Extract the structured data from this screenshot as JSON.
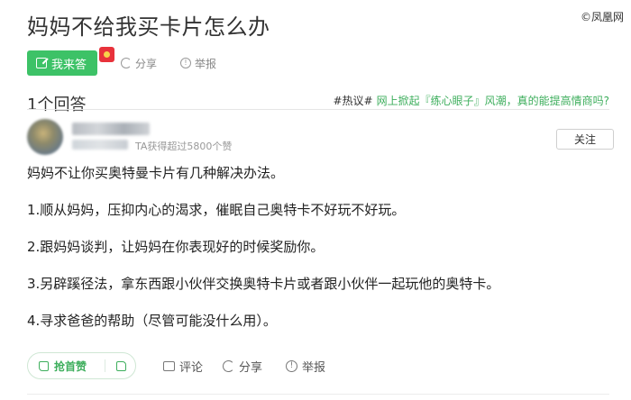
{
  "watermark": "©凤凰网",
  "question": {
    "title": "妈妈不给我买卡片怎么办"
  },
  "actions": {
    "answer_label": "我来答",
    "share_label": "分享",
    "report_label": "举报"
  },
  "answers_header": {
    "count_label": "1个回答",
    "hot_tag": "#热议#",
    "hot_text": "网上掀起『练心眼子』风潮，真的能提高情商吗?"
  },
  "author": {
    "likes_text": "TA获得超过5800个赞",
    "follow_label": "关注"
  },
  "answer": {
    "paragraphs": [
      "妈妈不让你买奥特曼卡片有几种解决办法。",
      "1.顺从妈妈，压抑内心的渴求，催眠自己奥特卡不好玩不好玩。",
      "2.跟妈妈谈判，让妈妈在你表现好的时候奖励你。",
      "3.另辟蹊径法，拿东西跟小伙伴交换奥特卡片或者跟小伙伴一起玩他的奥特卡。",
      "4.寻求爸爸的帮助（尽管可能没什么用）。"
    ]
  },
  "bottom": {
    "upvote_label": "抢首赞",
    "comment_label": "评论",
    "share_label": "分享",
    "report_label": "举报"
  },
  "colors": {
    "accent_green": "#3dc267",
    "hot_green": "#3dae5c"
  }
}
